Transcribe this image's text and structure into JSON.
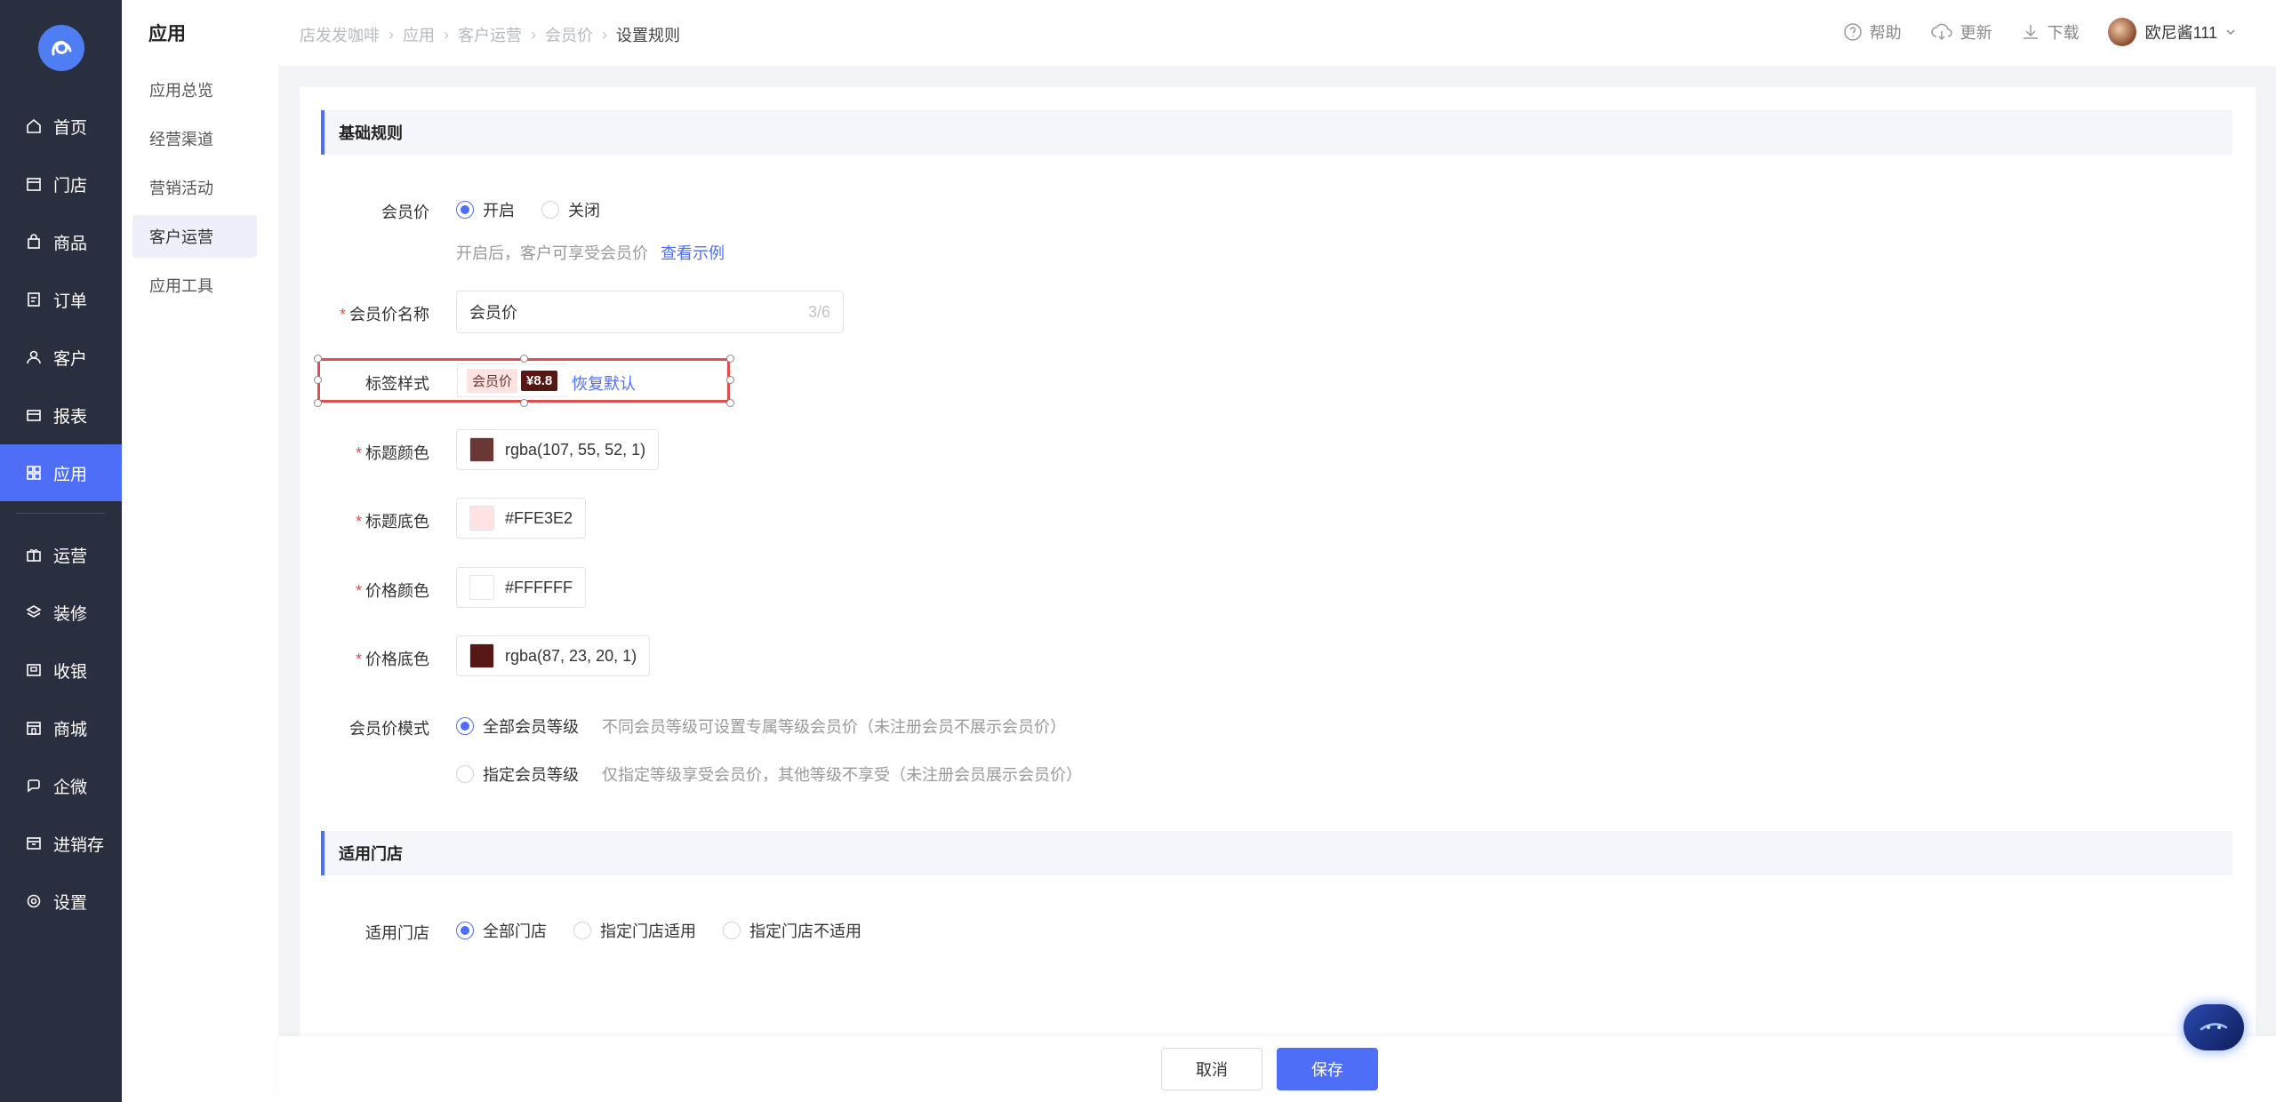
{
  "nav": {
    "items": [
      {
        "label": "首页",
        "icon": "home-icon"
      },
      {
        "label": "门店",
        "icon": "store-icon"
      },
      {
        "label": "商品",
        "icon": "bag-icon"
      },
      {
        "label": "订单",
        "icon": "order-icon"
      },
      {
        "label": "客户",
        "icon": "user-icon"
      },
      {
        "label": "报表",
        "icon": "report-icon"
      },
      {
        "label": "应用",
        "icon": "grid-icon"
      },
      {
        "label": "运营",
        "icon": "gift-icon"
      },
      {
        "label": "装修",
        "icon": "layers-icon"
      },
      {
        "label": "收银",
        "icon": "cashier-icon"
      },
      {
        "label": "商城",
        "icon": "mall-icon"
      },
      {
        "label": "企微",
        "icon": "chat-icon"
      },
      {
        "label": "进销存",
        "icon": "inventory-icon"
      },
      {
        "label": "设置",
        "icon": "gear-icon"
      }
    ],
    "active": "应用",
    "accent": "#4f6ef7"
  },
  "subnav": {
    "title": "应用",
    "items": [
      "应用总览",
      "经营渠道",
      "营销活动",
      "客户运营",
      "应用工具"
    ],
    "active": "客户运营"
  },
  "header": {
    "breadcrumb": [
      "店发发咖啡",
      "应用",
      "客户运营",
      "会员价",
      "设置规则"
    ],
    "help": "帮助",
    "update": "更新",
    "download": "下载",
    "user": "欧尼酱111"
  },
  "form": {
    "basic_section": "基础规则",
    "member_price": {
      "label": "会员价",
      "on": "开启",
      "off": "关闭",
      "hint": "开启后，客户可享受会员价",
      "example_link": "查看示例"
    },
    "name": {
      "label": "会员价名称",
      "value": "会员价",
      "count": "3/6"
    },
    "tag_style": {
      "label": "标签样式",
      "tag_title": "会员价",
      "tag_price": "¥8.8",
      "reset": "恢复默认"
    },
    "title_color": {
      "label": "标题颜色",
      "value": "rgba(107, 55, 52, 1)",
      "swatch": "#6b3734"
    },
    "title_bg": {
      "label": "标题底色",
      "value": "#FFE3E2",
      "swatch": "#FFE3E2"
    },
    "price_color": {
      "label": "价格颜色",
      "value": "#FFFFFF",
      "swatch": "#FFFFFF"
    },
    "price_bg": {
      "label": "价格底色",
      "value": "rgba(87, 23, 20, 1)",
      "swatch": "#571714"
    },
    "mode": {
      "label": "会员价模式",
      "all": "全部会员等级",
      "all_hint": "不同会员等级可设置专属等级会员价（未注册会员不展示会员价）",
      "specific": "指定会员等级",
      "specific_hint": "仅指定等级享受会员价，其他等级不享受（未注册会员展示会员价）"
    },
    "store_section": "适用门店",
    "stores": {
      "label": "适用门店",
      "all": "全部门店",
      "include": "指定门店适用",
      "exclude": "指定门店不适用"
    }
  },
  "footer": {
    "cancel": "取消",
    "save": "保存"
  }
}
